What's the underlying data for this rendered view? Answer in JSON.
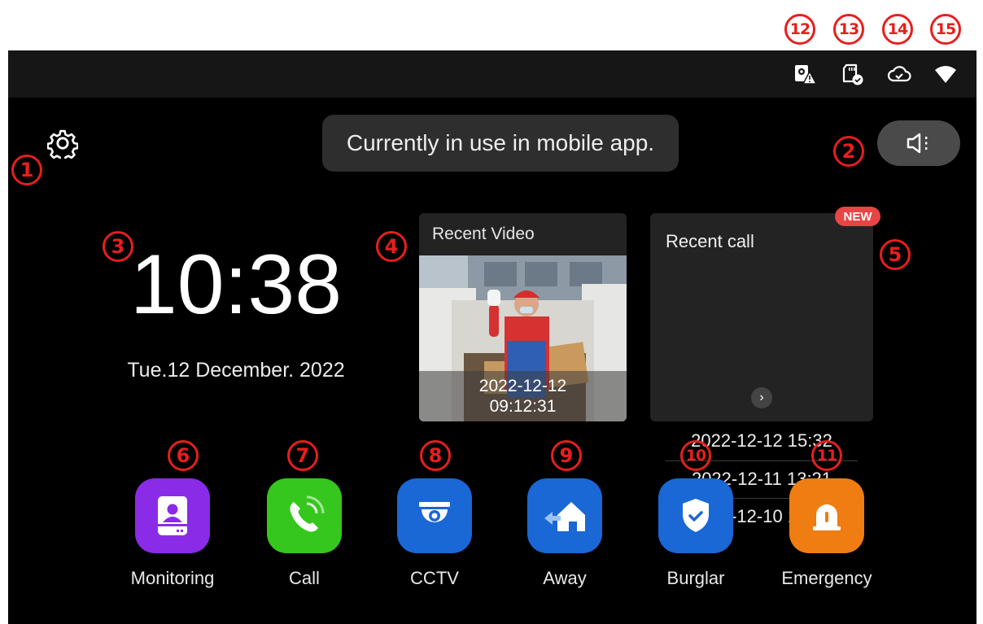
{
  "callouts": [
    "1",
    "2",
    "3",
    "4",
    "5",
    "6",
    "7",
    "8",
    "9",
    "10",
    "11",
    "12",
    "13",
    "14",
    "15"
  ],
  "status_icons": [
    "cctv-alert-icon",
    "sd-card-check-icon",
    "cloud-check-icon",
    "wifi-icon"
  ],
  "toast": {
    "message": "Currently in use in mobile app."
  },
  "clock": {
    "time": "10:38",
    "date": "Tue.12 December. 2022"
  },
  "recent_video": {
    "title": "Recent Video",
    "date": "2022-12-12",
    "time": "09:12:31"
  },
  "recent_call": {
    "title": "Recent call",
    "badge": "NEW",
    "items": [
      "2022-12-12 15:32",
      "2022-12-11 13:21",
      "2022-12-10 18:01"
    ],
    "more_glyph": "›"
  },
  "apps": [
    {
      "label": "Monitoring",
      "color": "#8a2be8",
      "icon": "monitoring-icon"
    },
    {
      "label": "Call",
      "color": "#35c71d",
      "icon": "call-icon"
    },
    {
      "label": "CCTV",
      "color": "#1a67d6",
      "icon": "cctv-icon"
    },
    {
      "label": "Away",
      "color": "#1a67d6",
      "icon": "away-home-icon"
    },
    {
      "label": "Burglar",
      "color": "#1a67d6",
      "icon": "shield-check-icon"
    },
    {
      "label": "Emergency",
      "color": "#ef7d12",
      "icon": "siren-icon"
    }
  ],
  "colors": {
    "callout": "#e81e1e",
    "screen_bg": "#000000",
    "card_bg": "#232323",
    "badge": "#e84545"
  }
}
